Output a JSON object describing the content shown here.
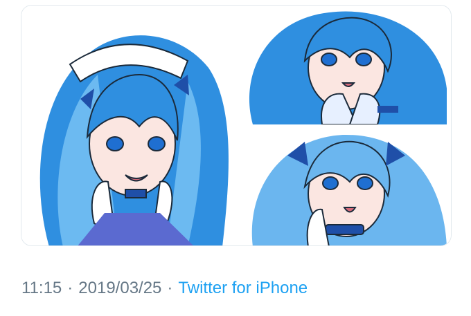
{
  "tweet": {
    "time": "11:15",
    "separator_1": "·",
    "date": "2019/03/25",
    "separator_2": "·",
    "source": "Twitter for iPhone"
  },
  "media": [
    {
      "description_icon": "illustration-blue-hair-maid-character"
    },
    {
      "description_icon": "illustration-blue-hair-character-fingers"
    },
    {
      "description_icon": "illustration-blue-hair-character-ribbons"
    }
  ],
  "colors": {
    "meta_text": "#657786",
    "link": "#1da1f2",
    "hair": "#2f8fe0",
    "hair_light": "#7cc4f5",
    "skin": "#fbe6e1",
    "outline": "#1b2a3a"
  }
}
